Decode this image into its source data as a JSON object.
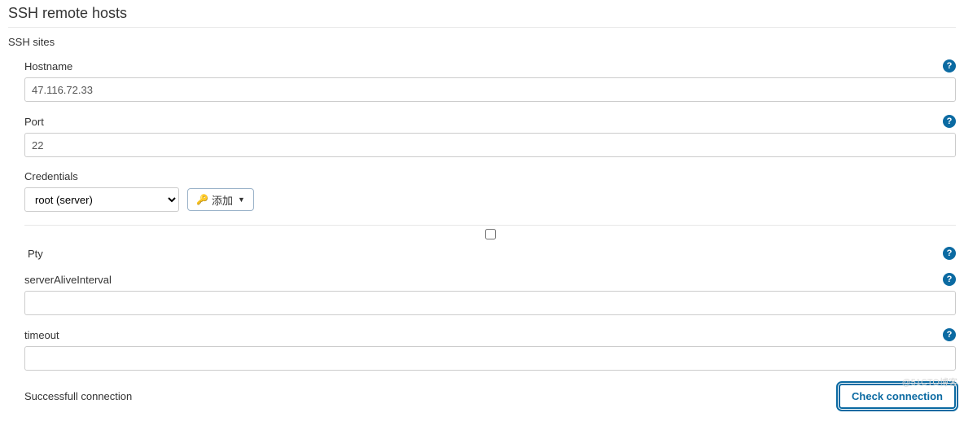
{
  "section": {
    "title": "SSH remote hosts",
    "subtitle": "SSH sites"
  },
  "fields": {
    "hostname": {
      "label": "Hostname",
      "value": "47.116.72.33"
    },
    "port": {
      "label": "Port",
      "value": "22"
    },
    "credentials": {
      "label": "Credentials",
      "selected": "root (server)",
      "add_label": "添加"
    },
    "pty": {
      "label": "Pty"
    },
    "serverAliveInterval": {
      "label": "serverAliveInterval",
      "value": ""
    },
    "timeout": {
      "label": "timeout",
      "value": ""
    }
  },
  "footer": {
    "status": "Successfull connection",
    "check_button": "Check connection"
  },
  "help_glyph": "?",
  "caret": "▼",
  "watermark": "@51CTO博客"
}
